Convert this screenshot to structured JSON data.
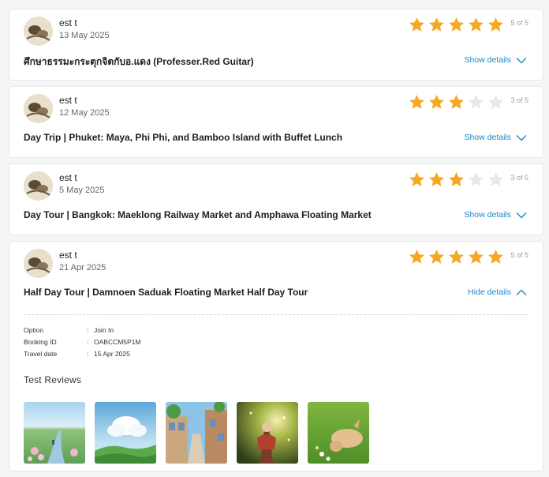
{
  "reviews": [
    {
      "user": "est  t",
      "date": "13 May 2025",
      "stars": 5,
      "rating_text": "5 of 5",
      "title": "ศึกษาธรรมะกระตุกจิตกับอ.แดง (Professer.Red Guitar)",
      "toggle_label": "Show details"
    },
    {
      "user": "est  t",
      "date": "12 May 2025",
      "stars": 3,
      "rating_text": "3 of 5",
      "title": "Day Trip | Phuket: Maya, Phi Phi, and Bamboo Island with Buffet Lunch",
      "toggle_label": "Show details"
    },
    {
      "user": "est  t",
      "date": "5 May 2025",
      "stars": 3,
      "rating_text": "3 of 5",
      "title": "Day Tour | Bangkok: Maeklong Railway Market and Amphawa Floating Market",
      "toggle_label": "Show details"
    },
    {
      "user": "est  t",
      "date": "21 Apr 2025",
      "stars": 5,
      "rating_text": "5 of 5",
      "title": "Half Day Tour | Damnoen Saduak Floating Market Half Day Tour",
      "toggle_label": "Hide details",
      "details": {
        "option_label": "Option",
        "option_value": "Join In",
        "booking_label": "Booking ID",
        "booking_value": "OABCCM5P1M",
        "travel_label": "Travel date",
        "travel_value": "15 Apr 2025",
        "separator": ":",
        "reviews_heading": "Test Reviews"
      }
    }
  ],
  "colors": {
    "star_filled": "#f7a823",
    "star_empty": "#e7e8ea",
    "link": "#1a86c8"
  },
  "icons": {
    "star": "star-icon",
    "chevron_down": "chevron-down-icon",
    "chevron_up": "chevron-up-icon"
  }
}
